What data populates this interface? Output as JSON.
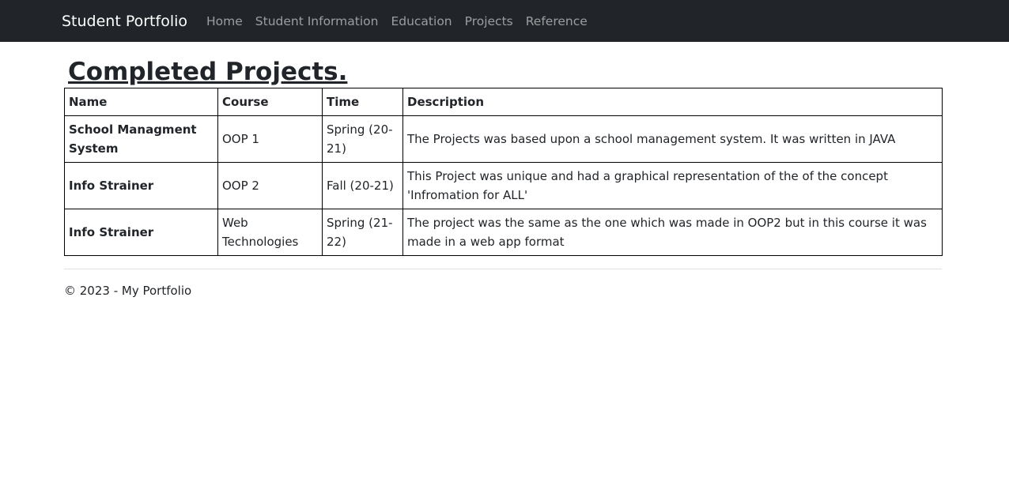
{
  "navbar": {
    "brand": "Student Portfolio",
    "links": [
      {
        "label": "Home"
      },
      {
        "label": "Student Information"
      },
      {
        "label": "Education"
      },
      {
        "label": "Projects"
      },
      {
        "label": "Reference"
      }
    ]
  },
  "main": {
    "title": "Completed Projects.",
    "table": {
      "headers": [
        "Name",
        "Course",
        "Time",
        "Description"
      ],
      "rows": [
        {
          "name": "School Managment System",
          "course": "OOP 1",
          "time": "Spring (20-21)",
          "description": "The Projects was based upon a school management system. It was written in JAVA"
        },
        {
          "name": "Info Strainer",
          "course": "OOP 2",
          "time": "Fall (20-21)",
          "description": "This Project was unique and had a graphical representation of the of the concept 'Infromation for ALL'"
        },
        {
          "name": "Info Strainer",
          "course": "Web Technologies",
          "time": "Spring (21-22)",
          "description": "The project was the same as the one which was made in OOP2 but in this course it was made in a web app format"
        }
      ]
    }
  },
  "footer": {
    "text": "© 2023 - My Portfolio"
  },
  "colors": {
    "navbar_bg": "#212529",
    "nav_link": "#9a9da0",
    "brand": "#ffffff",
    "text": "#212529"
  }
}
